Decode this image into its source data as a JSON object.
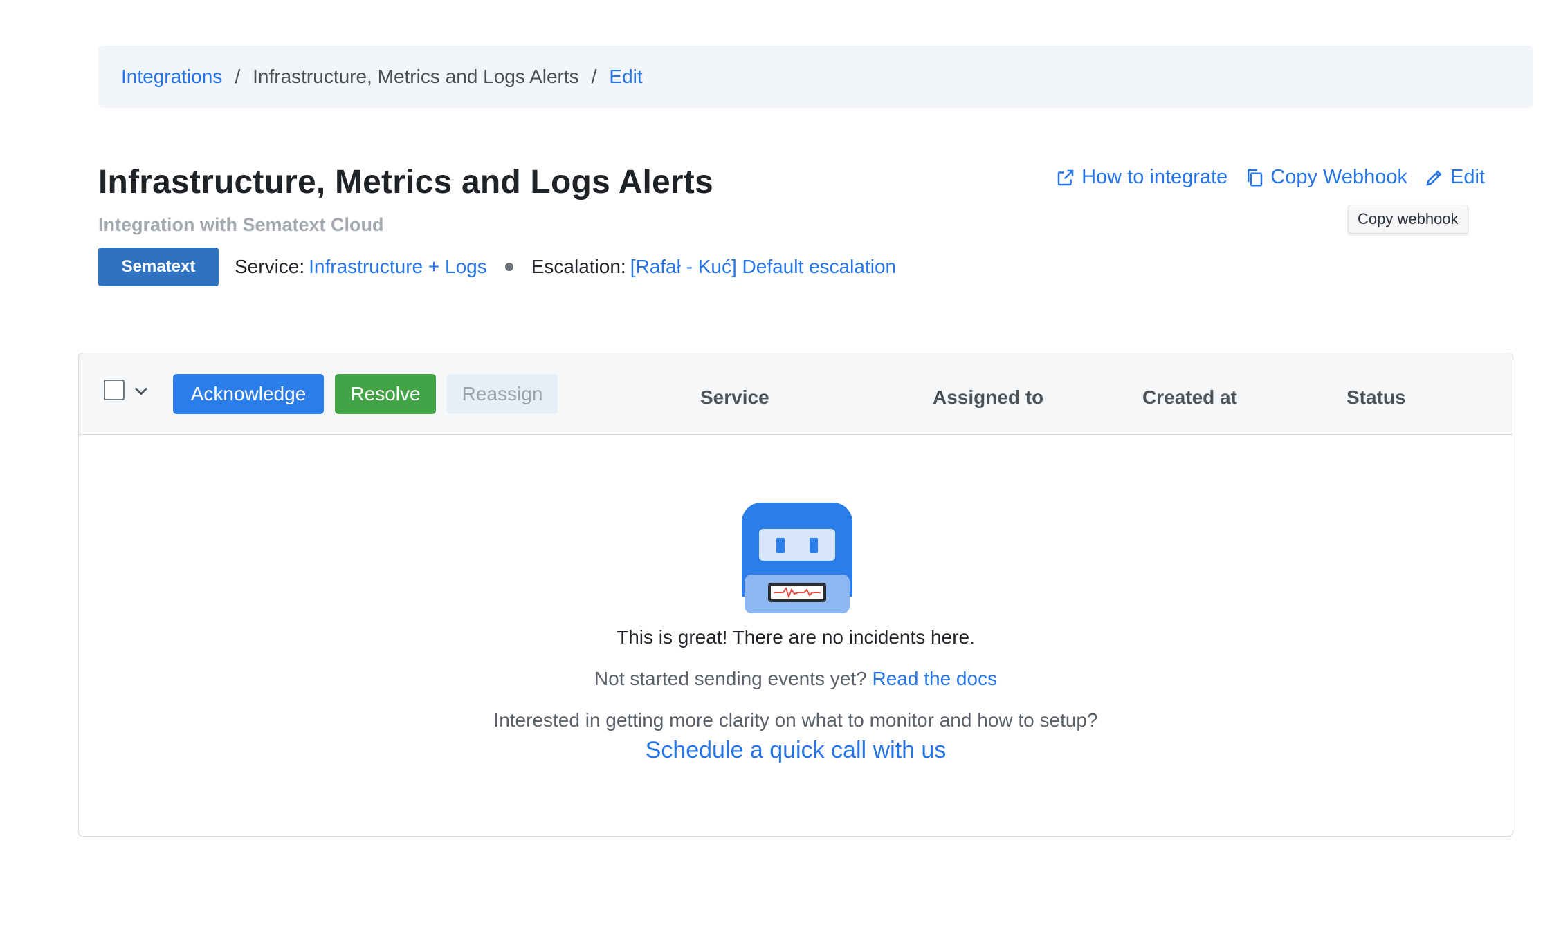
{
  "breadcrumb": {
    "items": [
      {
        "label": "Integrations",
        "link": true
      },
      {
        "label": "Infrastructure, Metrics and Logs Alerts",
        "link": false
      },
      {
        "label": "Edit",
        "link": true
      }
    ],
    "separator": "/"
  },
  "header": {
    "title": "Infrastructure, Metrics and Logs Alerts",
    "subtitle": "Integration with Sematext Cloud",
    "actions": {
      "how_to_integrate": "How to integrate",
      "copy_webhook": "Copy Webhook",
      "edit": "Edit"
    },
    "tooltip": "Copy webhook"
  },
  "meta": {
    "badge": "Sematext",
    "service_label": "Service:",
    "service_value": "Infrastructure + Logs",
    "escalation_label": "Escalation:",
    "escalation_value": "[Rafał - Kuć] Default escalation"
  },
  "table": {
    "buttons": {
      "acknowledge": "Acknowledge",
      "resolve": "Resolve",
      "reassign": "Reassign"
    },
    "columns": [
      "Service",
      "Assigned to",
      "Created at",
      "Status"
    ]
  },
  "empty_state": {
    "title": "This is great! There are no incidents here.",
    "not_started": "Not started sending events yet?",
    "read_docs": "Read the docs",
    "interested": "Interested in getting more clarity on what to monitor and how to setup?",
    "cta": "Schedule a quick call with us"
  },
  "colors": {
    "accent": "#2574e8",
    "badge": "#2f73c0",
    "resolve": "#42a347",
    "acknowledge": "#2b7de9"
  }
}
